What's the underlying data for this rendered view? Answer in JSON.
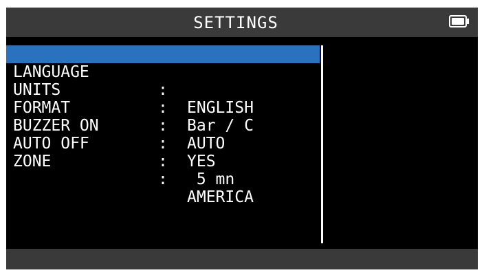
{
  "header": {
    "title": "SETTINGS",
    "battery_icon": "battery-full-icon"
  },
  "settings": [
    {
      "label": "LANGUAGE",
      "value": "ENGLISH",
      "selected": true
    },
    {
      "label": "UNITS",
      "value": "Bar / C"
    },
    {
      "label": "FORMAT",
      "value": "AUTO"
    },
    {
      "label": "BUZZER ON",
      "value": "YES"
    },
    {
      "label": "AUTO OFF",
      "value": " 5 mn"
    },
    {
      "label": "ZONE",
      "value": "AMERICA"
    }
  ],
  "separator": ":",
  "colors": {
    "screen_background": "#000000",
    "bar_background": "#3a3a3a",
    "selection": "#2a72bf",
    "text": "#ffffff"
  }
}
